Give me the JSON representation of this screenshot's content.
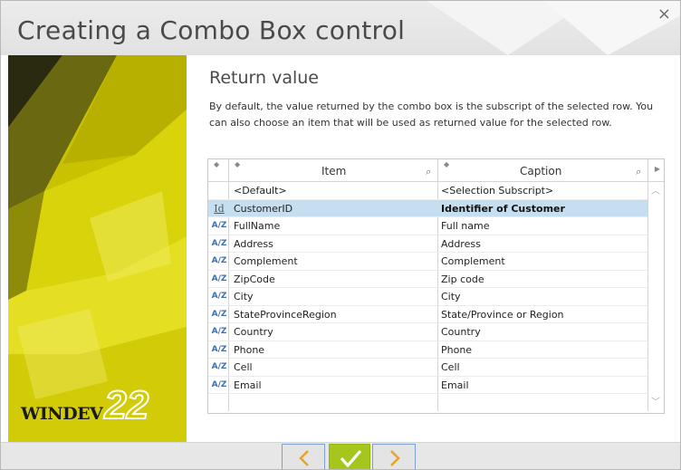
{
  "window": {
    "title": "Creating a Combo Box control",
    "close_glyph": "×"
  },
  "brand": {
    "name": "WINDEV",
    "version": "22"
  },
  "section": {
    "title": "Return value",
    "description": "By default, the value returned by the combo box is the subscript of the selected row. You can also choose an item that will be used as returned value for the selected row."
  },
  "table": {
    "columns": [
      "Item",
      "Caption"
    ],
    "rows": [
      {
        "icon": "none",
        "item": "<Default>",
        "caption": "<Selection Subscript>"
      },
      {
        "icon": "key-id-icon",
        "item": "CustomerID",
        "caption": "Identifier of Customer",
        "selected": true
      },
      {
        "icon": "text-az-icon",
        "item": "FullName",
        "caption": "Full name"
      },
      {
        "icon": "text-az-icon",
        "item": "Address",
        "caption": "Address"
      },
      {
        "icon": "text-az-icon",
        "item": "Complement",
        "caption": "Complement"
      },
      {
        "icon": "text-az-icon",
        "item": "ZipCode",
        "caption": "Zip code"
      },
      {
        "icon": "text-az-icon",
        "item": "City",
        "caption": "City"
      },
      {
        "icon": "text-az-icon",
        "item": "StateProvinceRegion",
        "caption": "State/Province or Region"
      },
      {
        "icon": "text-az-icon",
        "item": "Country",
        "caption": "Country"
      },
      {
        "icon": "text-az-icon",
        "item": "Phone",
        "caption": "Phone"
      },
      {
        "icon": "text-az-icon",
        "item": "Cell",
        "caption": "Cell"
      },
      {
        "icon": "text-az-icon",
        "item": "Email",
        "caption": "Email"
      }
    ],
    "az_glyph": "A/Z",
    "key_glyph": "Id"
  },
  "colors": {
    "accent_green": "#a5c61d",
    "side_yellow": "#c9c400",
    "selection": "#c5dff0",
    "nav_border": "#7aa0d6"
  }
}
